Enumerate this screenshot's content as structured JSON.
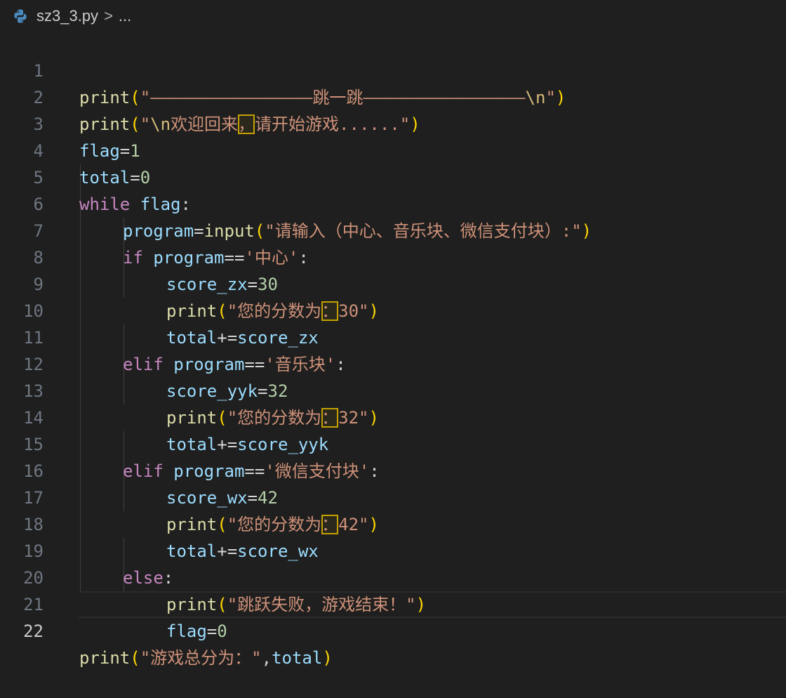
{
  "breadcrumb": {
    "file_name": "sz3_3.py",
    "separator": ">",
    "more": "..."
  },
  "icons": {
    "python": "python-file-icon"
  },
  "colors": {
    "background": "#1f1f1f",
    "function": "#dcdcaa",
    "string": "#ce9178",
    "variable": "#9cdcfe",
    "number": "#b5cea8",
    "keyword": "#c586c0",
    "bracket": "#ffd700",
    "highlight_border": "#c5a100"
  },
  "editor": {
    "current_line": 22,
    "lines": [
      {
        "n": "1",
        "t": {
          "a": "print",
          "b": "(",
          "c": "\"",
          "d": "————————————————跳一跳————————————————",
          "e": "\\n",
          "f": "\"",
          "g": ")"
        }
      },
      {
        "n": "2",
        "t": {
          "a": "print",
          "b": "(",
          "c": "\"",
          "d": "\\n",
          "e": "欢迎回来",
          "f": "，",
          "g": "请开始游戏......",
          "h": "\"",
          "i": ")"
        }
      },
      {
        "n": "3",
        "t": {
          "a": "flag",
          "b": "=",
          "c": "1"
        }
      },
      {
        "n": "4",
        "t": {
          "a": "total",
          "b": "=",
          "c": "0"
        }
      },
      {
        "n": "5",
        "t": {
          "a": "while",
          "b": " ",
          "c": "flag",
          "d": ":"
        }
      },
      {
        "n": "6",
        "t": {
          "a": "program",
          "b": "=",
          "c": "input",
          "d": "(",
          "e": "\"请输入（中心、音乐块、微信支付块）:\"",
          "f": ")"
        }
      },
      {
        "n": "7",
        "t": {
          "a": "if",
          "b": " ",
          "c": "program",
          "d": "==",
          "e": "'中心'",
          "f": ":"
        }
      },
      {
        "n": "8",
        "t": {
          "a": "score_zx",
          "b": "=",
          "c": "30"
        }
      },
      {
        "n": "9",
        "t": {
          "a": "print",
          "b": "(",
          "c": "\"您的分数为",
          "d": "：",
          "e": "30\"",
          "f": ")"
        }
      },
      {
        "n": "10",
        "t": {
          "a": "total",
          "b": "+=",
          "c": "score_zx"
        }
      },
      {
        "n": "11",
        "t": {
          "a": "elif",
          "b": " ",
          "c": "program",
          "d": "==",
          "e": "'音乐块'",
          "f": ":"
        }
      },
      {
        "n": "12",
        "t": {
          "a": "score_yyk",
          "b": "=",
          "c": "32"
        }
      },
      {
        "n": "13",
        "t": {
          "a": "print",
          "b": "(",
          "c": "\"您的分数为",
          "d": "：",
          "e": "32\"",
          "f": ")"
        }
      },
      {
        "n": "14",
        "t": {
          "a": "total",
          "b": "+=",
          "c": "score_yyk"
        }
      },
      {
        "n": "15",
        "t": {
          "a": "elif",
          "b": " ",
          "c": "program",
          "d": "==",
          "e": "'微信支付块'",
          "f": ":"
        }
      },
      {
        "n": "16",
        "t": {
          "a": "score_wx",
          "b": "=",
          "c": "42"
        }
      },
      {
        "n": "17",
        "t": {
          "a": "print",
          "b": "(",
          "c": "\"您的分数为",
          "d": "：",
          "e": "42\"",
          "f": ")"
        }
      },
      {
        "n": "18",
        "t": {
          "a": "total",
          "b": "+=",
          "c": "score_wx"
        }
      },
      {
        "n": "19",
        "t": {
          "a": "else",
          "b": ":"
        }
      },
      {
        "n": "20",
        "t": {
          "a": "print",
          "b": "(",
          "c": "\"跳跃失败，游戏结束！\"",
          "d": ")"
        }
      },
      {
        "n": "21",
        "t": {
          "a": "flag",
          "b": "=",
          "c": "0"
        }
      },
      {
        "n": "22",
        "t": {
          "a": "print",
          "b": "(",
          "c": "\"游戏总分为：\"",
          "d": ",",
          "e": "total",
          "f": ")"
        }
      }
    ]
  }
}
